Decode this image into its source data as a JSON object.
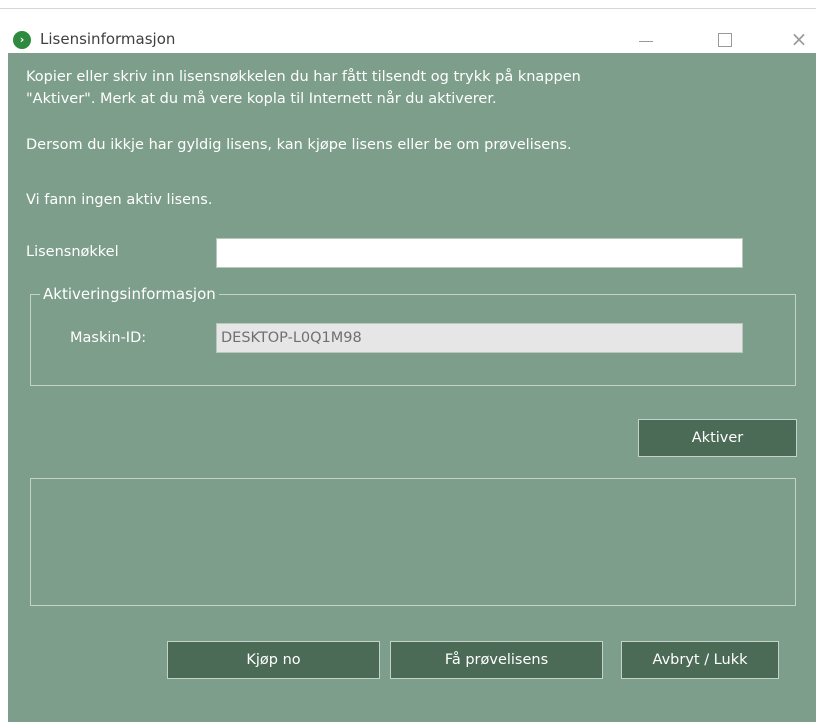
{
  "window": {
    "title": "Lisensinformasjon",
    "close_glyph": "×"
  },
  "intro": {
    "line1": "Kopier eller skriv inn lisensnøkkelen du har fått tilsendt og trykk på knappen",
    "line2": "\"Aktiver\". Merk at du må vere kopla til Internett når du aktiverer.",
    "line3": "Dersom du ikkje har gyldig lisens, kan kjøpe lisens eller be om prøvelisens."
  },
  "status": "Vi fann ingen aktiv lisens.",
  "license_key": {
    "label": "Lisensnøkkel",
    "value": ""
  },
  "activation": {
    "legend": "Aktiveringsinformasjon",
    "machine_id_label": "Maskin-ID:",
    "machine_id_value": "DESKTOP-L0Q1M98"
  },
  "buttons": {
    "activate": "Aktiver",
    "buy": "Kjøp no",
    "trial": "Få prøvelisens",
    "cancel_close": "Avbryt / Lukk"
  },
  "colors": {
    "background": "#7d9e8a",
    "button": "#4b6b56",
    "icon": "#2d8a3e"
  },
  "icons": [
    "app-logo-icon",
    "minimize-icon",
    "maximize-icon",
    "close-icon"
  ]
}
